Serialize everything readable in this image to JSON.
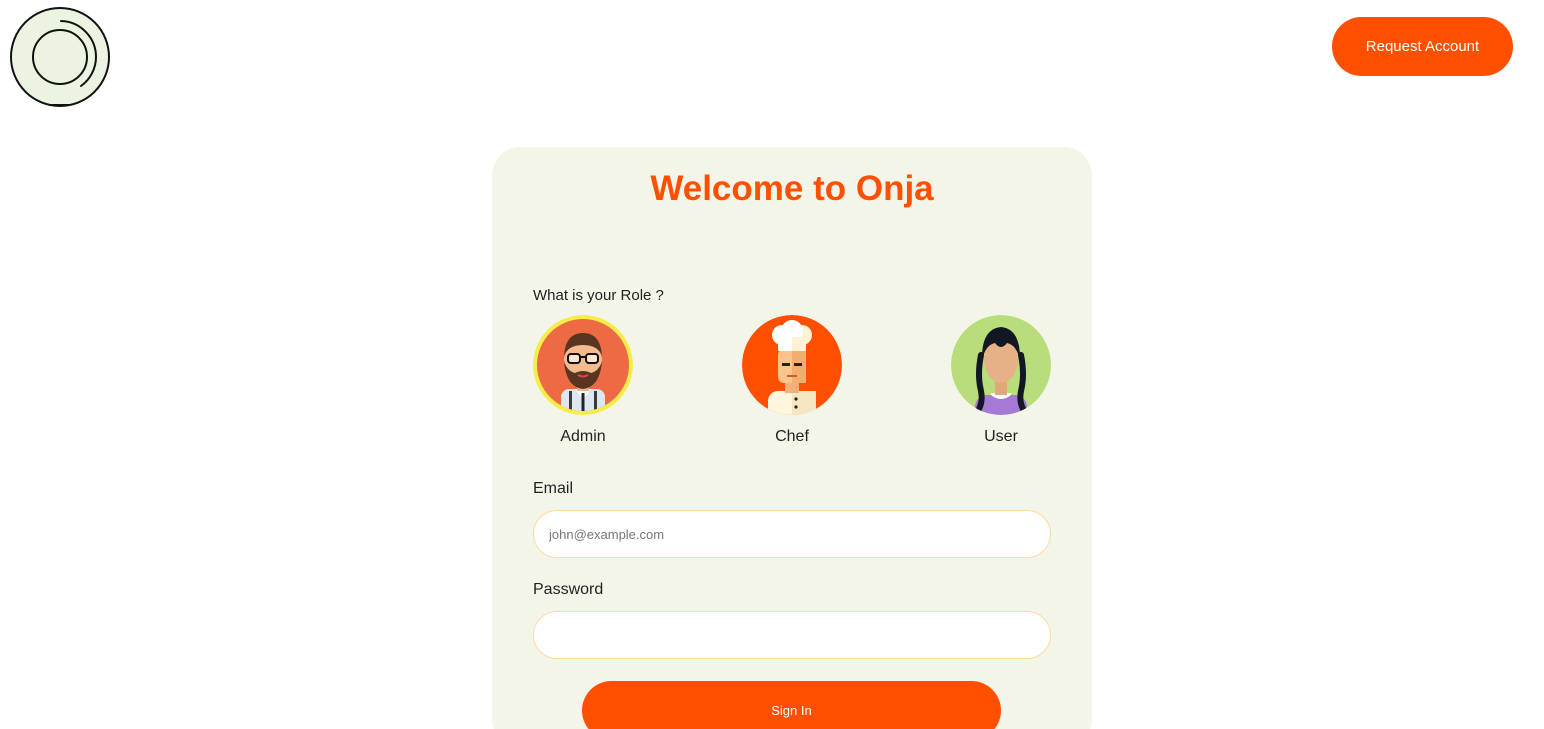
{
  "header": {
    "logo_icon": "onja-circle-logo-icon",
    "request_account_label": "Request Account"
  },
  "login": {
    "title": "Welcome to Onja",
    "role_question": "What is your Role ?",
    "roles": [
      {
        "label": "Admin",
        "icon": "bearded-man-avatar-icon",
        "selected": true
      },
      {
        "label": "Chef",
        "icon": "chef-avatar-icon",
        "selected": false
      },
      {
        "label": "User",
        "icon": "woman-braids-avatar-icon",
        "selected": false
      }
    ],
    "email_label": "Email",
    "email_placeholder": "john@example.com",
    "email_value": "",
    "password_label": "Password",
    "password_value": "",
    "sign_in_label": "Sign In"
  },
  "colors": {
    "accent": "#ff4f00",
    "card_bg": "#f4f5e9",
    "selected_ring": "#f5ed4a",
    "input_border": "#ffd9a0"
  }
}
